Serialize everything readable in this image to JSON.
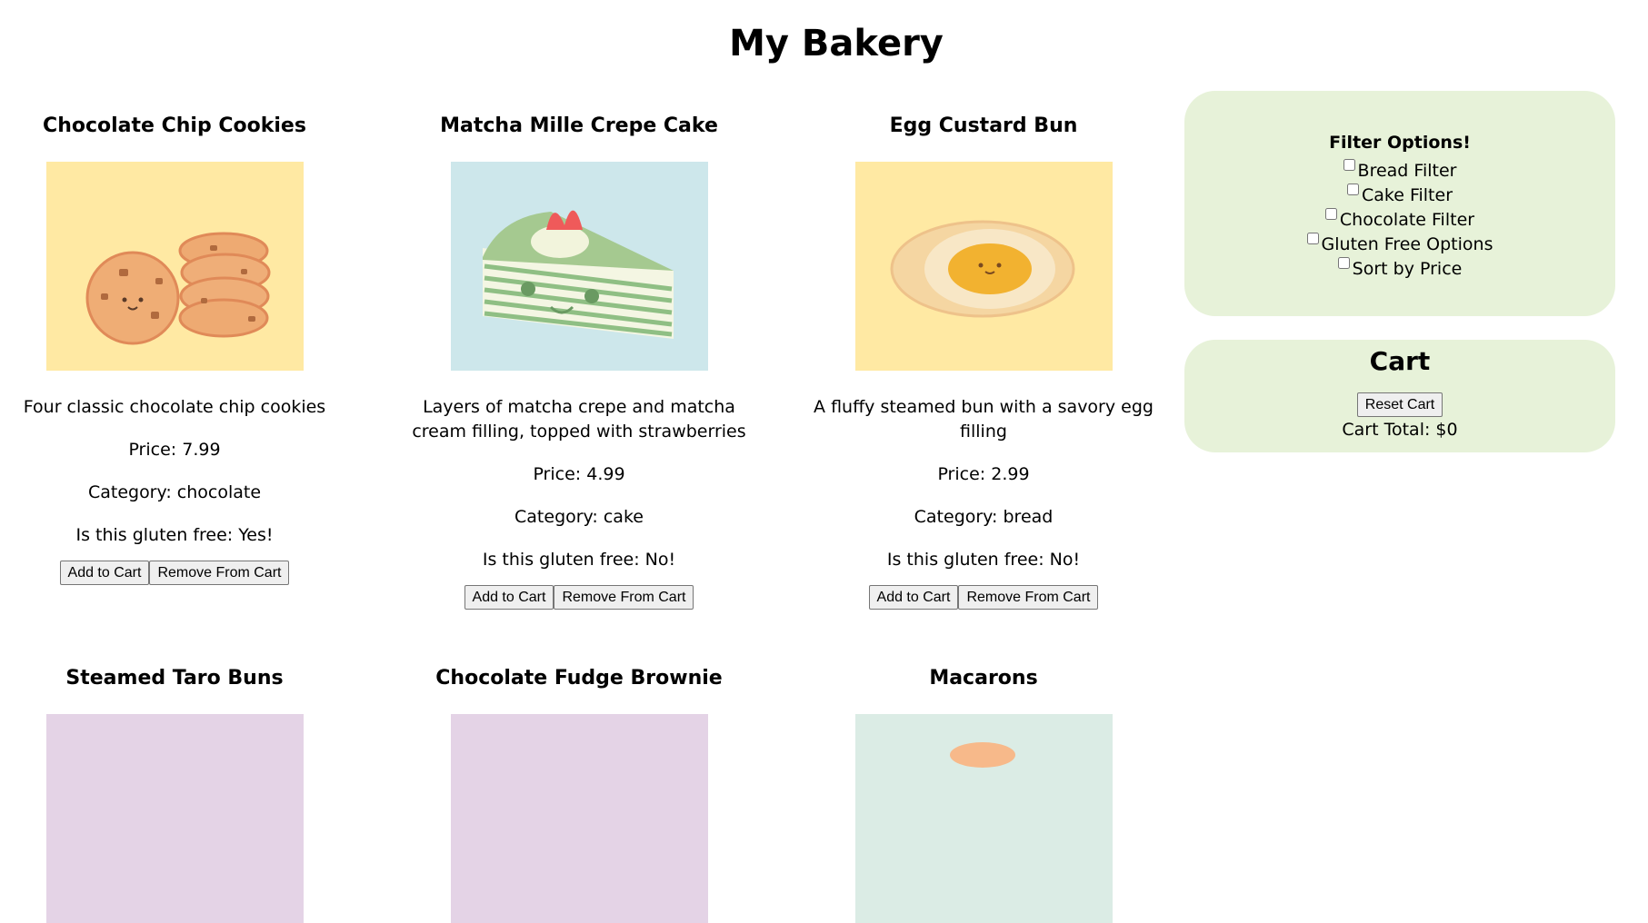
{
  "page": {
    "title": "My Bakery"
  },
  "products": [
    {
      "name": "Chocolate Chip Cookies",
      "description": "Four classic chocolate chip cookies",
      "price": "Price: 7.99",
      "category": "Category: chocolate",
      "gluten": "Is this gluten free: Yes!",
      "add_label": "Add to Cart",
      "remove_label": "Remove From Cart",
      "image_bg": "#ffe9a3",
      "image_icon": "cookies-image"
    },
    {
      "name": "Matcha Mille Crepe Cake",
      "description": "Layers of matcha crepe and matcha cream filling, topped with strawberries",
      "price": "Price: 4.99",
      "category": "Category: cake",
      "gluten": "Is this gluten free: No!",
      "add_label": "Add to Cart",
      "remove_label": "Remove From Cart",
      "image_bg": "#cde7eb",
      "image_icon": "crepe-cake-image"
    },
    {
      "name": "Egg Custard Bun",
      "description": "A fluffy steamed bun with a savory egg filling",
      "price": "Price: 2.99",
      "category": "Category: bread",
      "gluten": "Is this gluten free: No!",
      "add_label": "Add to Cart",
      "remove_label": "Remove From Cart",
      "image_bg": "#ffe9a3",
      "image_icon": "custard-bun-image"
    },
    {
      "name": "Steamed Taro Buns",
      "image_bg": "#e4d3e6",
      "image_icon": "taro-bun-image"
    },
    {
      "name": "Chocolate Fudge Brownie",
      "image_bg": "#e4d3e6",
      "image_icon": "brownie-image"
    },
    {
      "name": "Macarons",
      "image_bg": "#dbece5",
      "image_icon": "macarons-image"
    }
  ],
  "filters": {
    "title": "Filter Options!",
    "options": [
      {
        "label": "Bread Filter",
        "checked": false
      },
      {
        "label": "Cake Filter",
        "checked": false
      },
      {
        "label": "Chocolate Filter",
        "checked": false
      },
      {
        "label": "Gluten Free Options",
        "checked": false
      },
      {
        "label": "Sort by Price",
        "checked": false
      }
    ]
  },
  "cart": {
    "title": "Cart",
    "reset_label": "Reset Cart",
    "total": "Cart Total: $0"
  },
  "colors": {
    "panel_bg": "#e7f2d9",
    "yellow_bg": "#ffe9a3",
    "blue_bg": "#cde7eb",
    "purple_bg": "#e4d3e6",
    "mint_bg": "#dbece5"
  }
}
